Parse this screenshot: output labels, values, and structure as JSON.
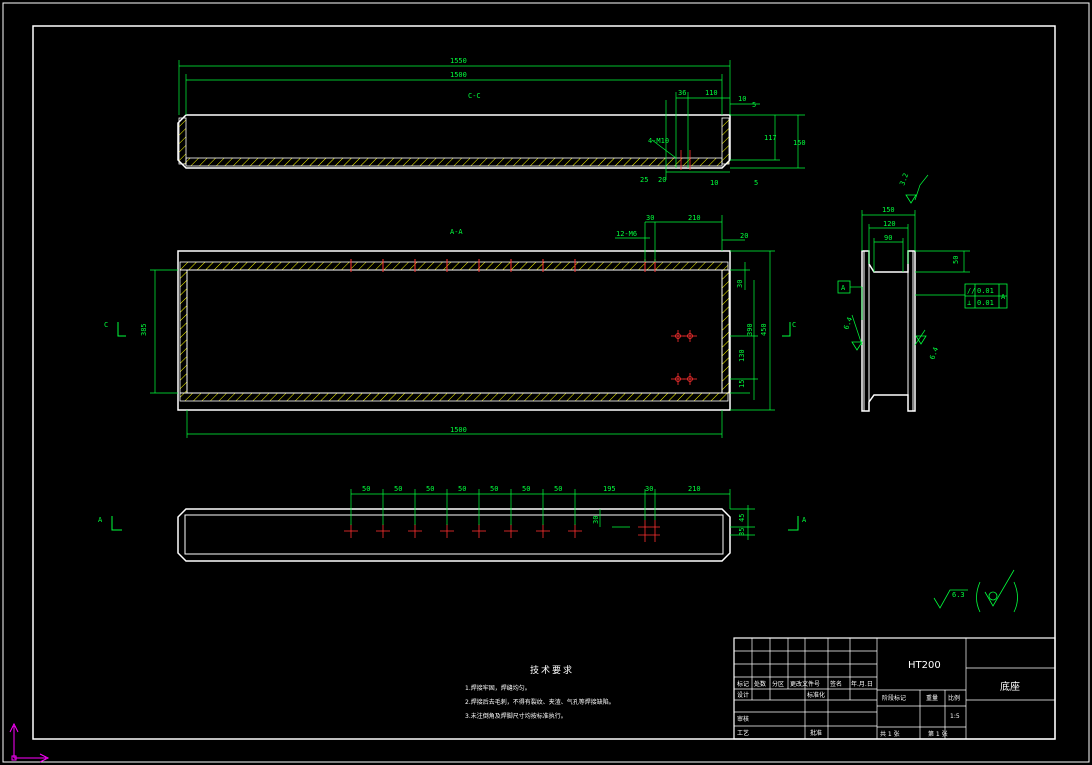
{
  "drawing": {
    "material": "HT200",
    "part_name": "底座",
    "scale": "1:5",
    "sheet_total": "共 1 张",
    "sheet_no": "第 1 张"
  },
  "tech_requirements": {
    "title": "技术要求",
    "items": [
      "1.焊接牢固，焊缝均匀。",
      "2.焊接后去毛刺，不得有裂纹、夹渣、气孔等焊接缺陷。",
      "3.未注倒角及焊脚尺寸均按标准执行。"
    ]
  },
  "title_block": {
    "labels": [
      "标记",
      "处数",
      "分区",
      "更改文件号",
      "签名",
      "年.月.日",
      "设计",
      "标准化",
      "阶段标记",
      "重量",
      "比例",
      "审核",
      "工艺",
      "批准"
    ]
  },
  "dims": {
    "top_view": {
      "overall": "1550",
      "inner": "1500",
      "section_mark": "C-C",
      "d36": "36",
      "d110": "110",
      "d10a": "10",
      "d5a": "5",
      "d117": "117",
      "d150": "150",
      "d10b": "10",
      "d5b": "5",
      "d25": "25",
      "d20": "20",
      "thread": "4-M10"
    },
    "plan_view": {
      "section_mark": "A-A",
      "d30": "30",
      "d210": "210",
      "d20": "20",
      "thread": "12-M6",
      "d385": "385",
      "d30b": "30",
      "d450": "450",
      "d390": "390",
      "d130": "130",
      "d15": "15",
      "bottom": "1500",
      "cut_left": "C",
      "cut_right": "C"
    },
    "bottom_view": {
      "spacing": [
        "50",
        "50",
        "50",
        "50",
        "50",
        "50",
        "50"
      ],
      "d195": "195",
      "d30": "30",
      "d210": "210",
      "d45": "45",
      "d35": "35",
      "d30b": "30",
      "cut_left": "A",
      "cut_right": "A"
    },
    "side_view": {
      "d150": "150",
      "d120": "120",
      "d90": "90",
      "d50": "50",
      "datum": "A",
      "rough_top": "3.2",
      "rough_left": "6.4",
      "rough_right": "6.4",
      "parallel": "0.01",
      "perp": "0.01",
      "datum_ref": "A"
    },
    "roughness_general": "6.3"
  },
  "colors": {
    "line": "#ffffff",
    "dimension": "#00ff3c",
    "hatch": "#ffff00",
    "center": "#ff3030",
    "ucs": "#ff00ff"
  }
}
